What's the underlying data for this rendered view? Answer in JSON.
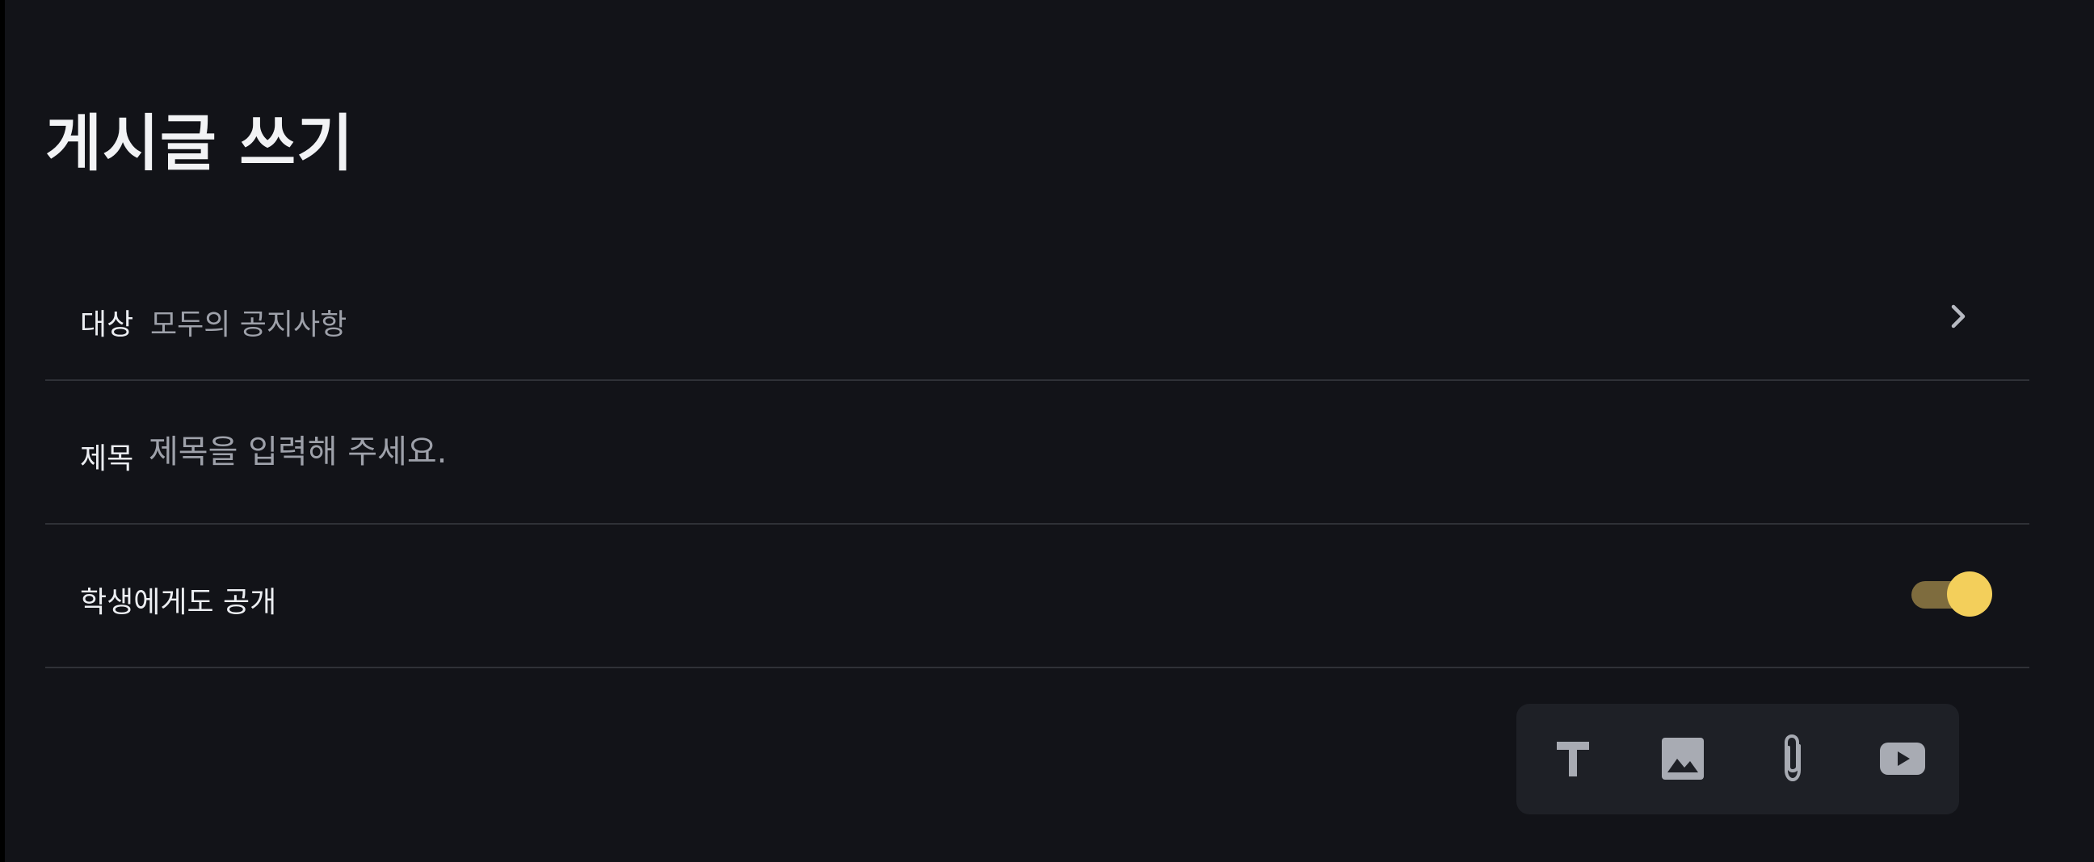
{
  "header": {
    "title": "게시글 쓰기"
  },
  "form": {
    "target": {
      "label": "대상",
      "value": "모두의 공지사항",
      "chevron_icon": "chevron-right-icon"
    },
    "title_field": {
      "label": "제목",
      "value": "",
      "placeholder": "제목을 입력해 주세요."
    },
    "public_to_students": {
      "label": "학생에게도 공개",
      "enabled": true
    }
  },
  "toolbar": {
    "tools": [
      {
        "icon": "text-icon"
      },
      {
        "icon": "image-icon"
      },
      {
        "icon": "paperclip-icon"
      },
      {
        "icon": "video-icon"
      }
    ]
  },
  "colors": {
    "background": "#121318",
    "toggle_knob": "#f3cf5b",
    "toggle_track": "#7e6c3e",
    "toolbar_bg": "#1e2026"
  }
}
